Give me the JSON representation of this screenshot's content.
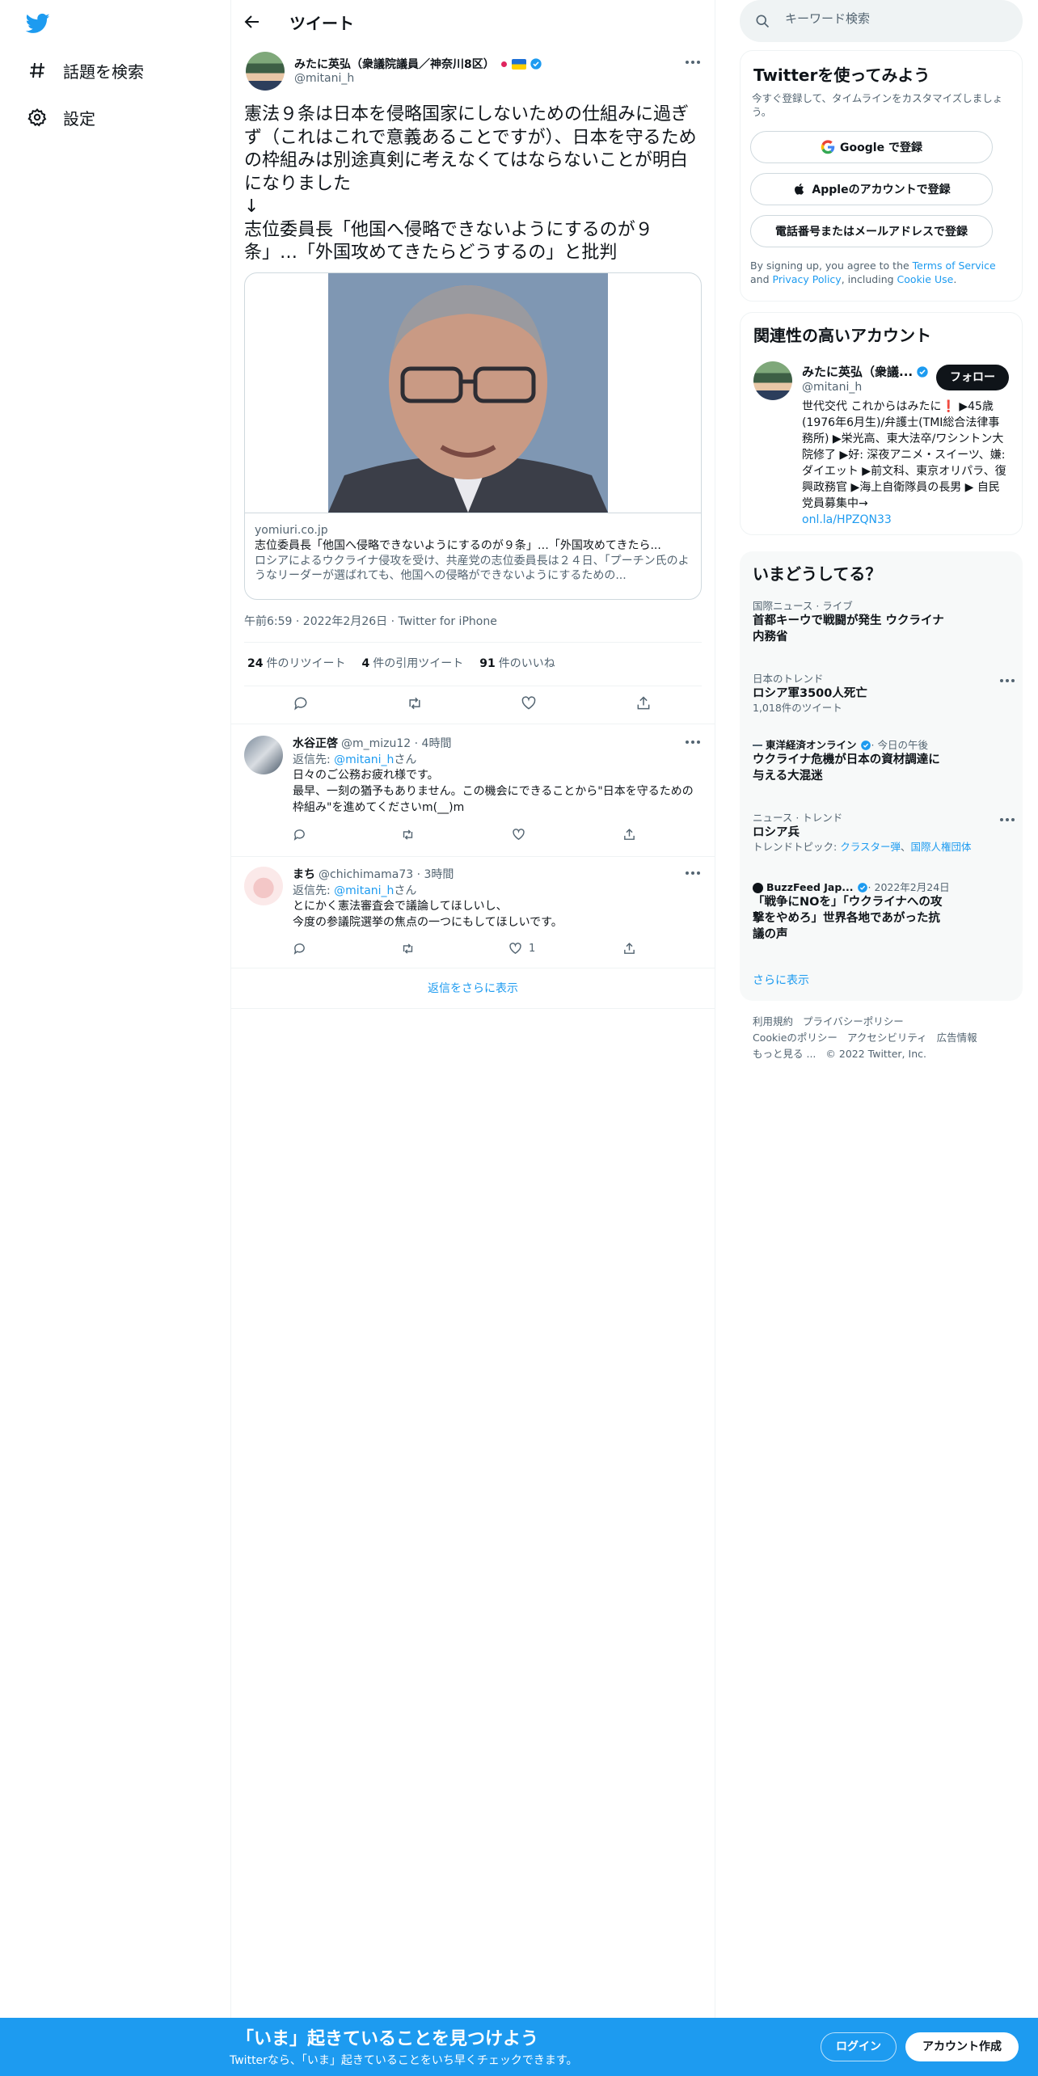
{
  "nav": {
    "logo": "twitter-bird",
    "explore": "話題を検索",
    "settings": "設定"
  },
  "header": {
    "title": "ツイート"
  },
  "tweet": {
    "author_name": "みたに英弘（衆議院議員／神奈川8区）",
    "author_handle": "@mitani_h",
    "text": "憲法９条は日本を侵略国家にしないための仕組みに過ぎず（これはこれで意義あることですが）、日本を守るための枠組みは別途真剣に考えなくてはならないことが明白になりました\n↓\n志位委員長「他国へ侵略できないようにするのが９条」…「外国攻めてきたらどうするの」と批判",
    "card": {
      "domain": "yomiuri.co.jp",
      "title": "志位委員長「他国へ侵略できないようにするのが９条」…「外国攻めてきたら...",
      "description": "ロシアによるウクライナ侵攻を受け、共産党の志位委員長は２４日、「プーチン氏のようなリーダーが選ばれても、他国への侵略ができないようにするための..."
    },
    "meta": "午前6:59 · 2022年2月26日 · Twitter for iPhone",
    "stats": {
      "retweets": "24",
      "retweets_label": "件のリツイート",
      "quotes": "4",
      "quotes_label": "件の引用ツイート",
      "likes": "91",
      "likes_label": "件のいいね"
    }
  },
  "replies": [
    {
      "name": "水谷正啓",
      "handle": "@m_mizu12",
      "time": "· 4時間",
      "reply_prefix": "返信先: ",
      "reply_to": "@mitani_h",
      "reply_suffix": "さん",
      "text": "日々のご公務お疲れ様です。\n最早、一刻の猶予もありません。この機会にできることから\"日本を守るための枠組み\"を進めてくださいm(__)m",
      "likes": ""
    },
    {
      "name": "まち",
      "handle": "@chichimama73",
      "time": "· 3時間",
      "reply_prefix": "返信先: ",
      "reply_to": "@mitani_h",
      "reply_suffix": "さん",
      "text": "とにかく憲法審査会で議論してほしいし、\n今度の参議院選挙の焦点の一つにもしてほしいです。",
      "likes": "1"
    }
  ],
  "show_more_replies": "返信をさらに表示",
  "search": {
    "placeholder": "キーワード検索"
  },
  "signup_panel": {
    "title": "Twitterを使ってみよう",
    "subtitle": "今すぐ登録して、タイムラインをカスタマイズしましょう。",
    "google": "Google で登録",
    "apple": "Appleのアカウントで登録",
    "phone": "電話番号またはメールアドレスで登録",
    "terms_1": "By signing up, you agree to the ",
    "terms_link": "Terms of Service",
    "terms_2": " and ",
    "privacy_link": "Privacy Policy",
    "terms_3": ", including ",
    "cookie_link": "Cookie Use",
    "terms_4": "."
  },
  "related": {
    "title": "関連性の高いアカウント",
    "name": "みたに英弘（衆議...",
    "handle": "@mitani_h",
    "follow": "フォロー",
    "bio": "世代交代 これからはみたに❗️ ▶45歳(1976年6月生)/弁護士(TMI総合法律事務所) ▶栄光高、東大法卒/ワシントン大院修了 ▶好: 深夜アニメ・スイーツ、嫌: ダイエット ▶前文科、東京オリパラ、復興政務官 ▶海上自衛隊員の長男 ▶ 自民党員募集中→",
    "bio_link": "onl.la/HPZQN33"
  },
  "trends": {
    "title": "いまどうしてる？",
    "items": [
      {
        "category": "国際ニュース · ライブ",
        "title": "首都キーウで戦闘が発生 ウクライナ内務省",
        "sub": ""
      },
      {
        "category": "日本のトレンド",
        "title": "ロシア軍3500人死亡",
        "sub": "1,018件のツイート"
      },
      {
        "category": "東洋経済オンライン",
        "category_suffix": " · 今日の午後",
        "title": "ウクライナ危機が日本の資材調達に与える大混迷",
        "sub": ""
      },
      {
        "category": "ニュース · トレンド",
        "title": "ロシア兵",
        "sub_prefix": "トレンドトピック: ",
        "sub_link1": "クラスター弾",
        "sub_sep": "、",
        "sub_link2": "国際人権団体"
      },
      {
        "category": "BuzzFeed Jap...",
        "category_suffix": " · 2022年2月24日",
        "title": "「戦争にNOを」「ウクライナへの攻撃をやめろ」世界各地であがった抗議の声",
        "sub": ""
      }
    ],
    "show_more": "さらに表示"
  },
  "footer": {
    "links": [
      "利用規約",
      "プライバシーポリシー",
      "Cookieのポリシー",
      "アクセシビリティ",
      "広告情報",
      "もっと見る ..."
    ],
    "copyright": "© 2022 Twitter, Inc."
  },
  "bottom_bar": {
    "title": "「いま」起きていることを見つけよう",
    "subtitle": "Twitterなら、「いま」起きていることをいち早くチェックできます。",
    "login": "ログイン",
    "signup": "アカウント作成"
  },
  "colors": {
    "accent": "#1d9bf0",
    "text": "#0f1419",
    "muted": "#536471",
    "border": "#eff3f4"
  }
}
